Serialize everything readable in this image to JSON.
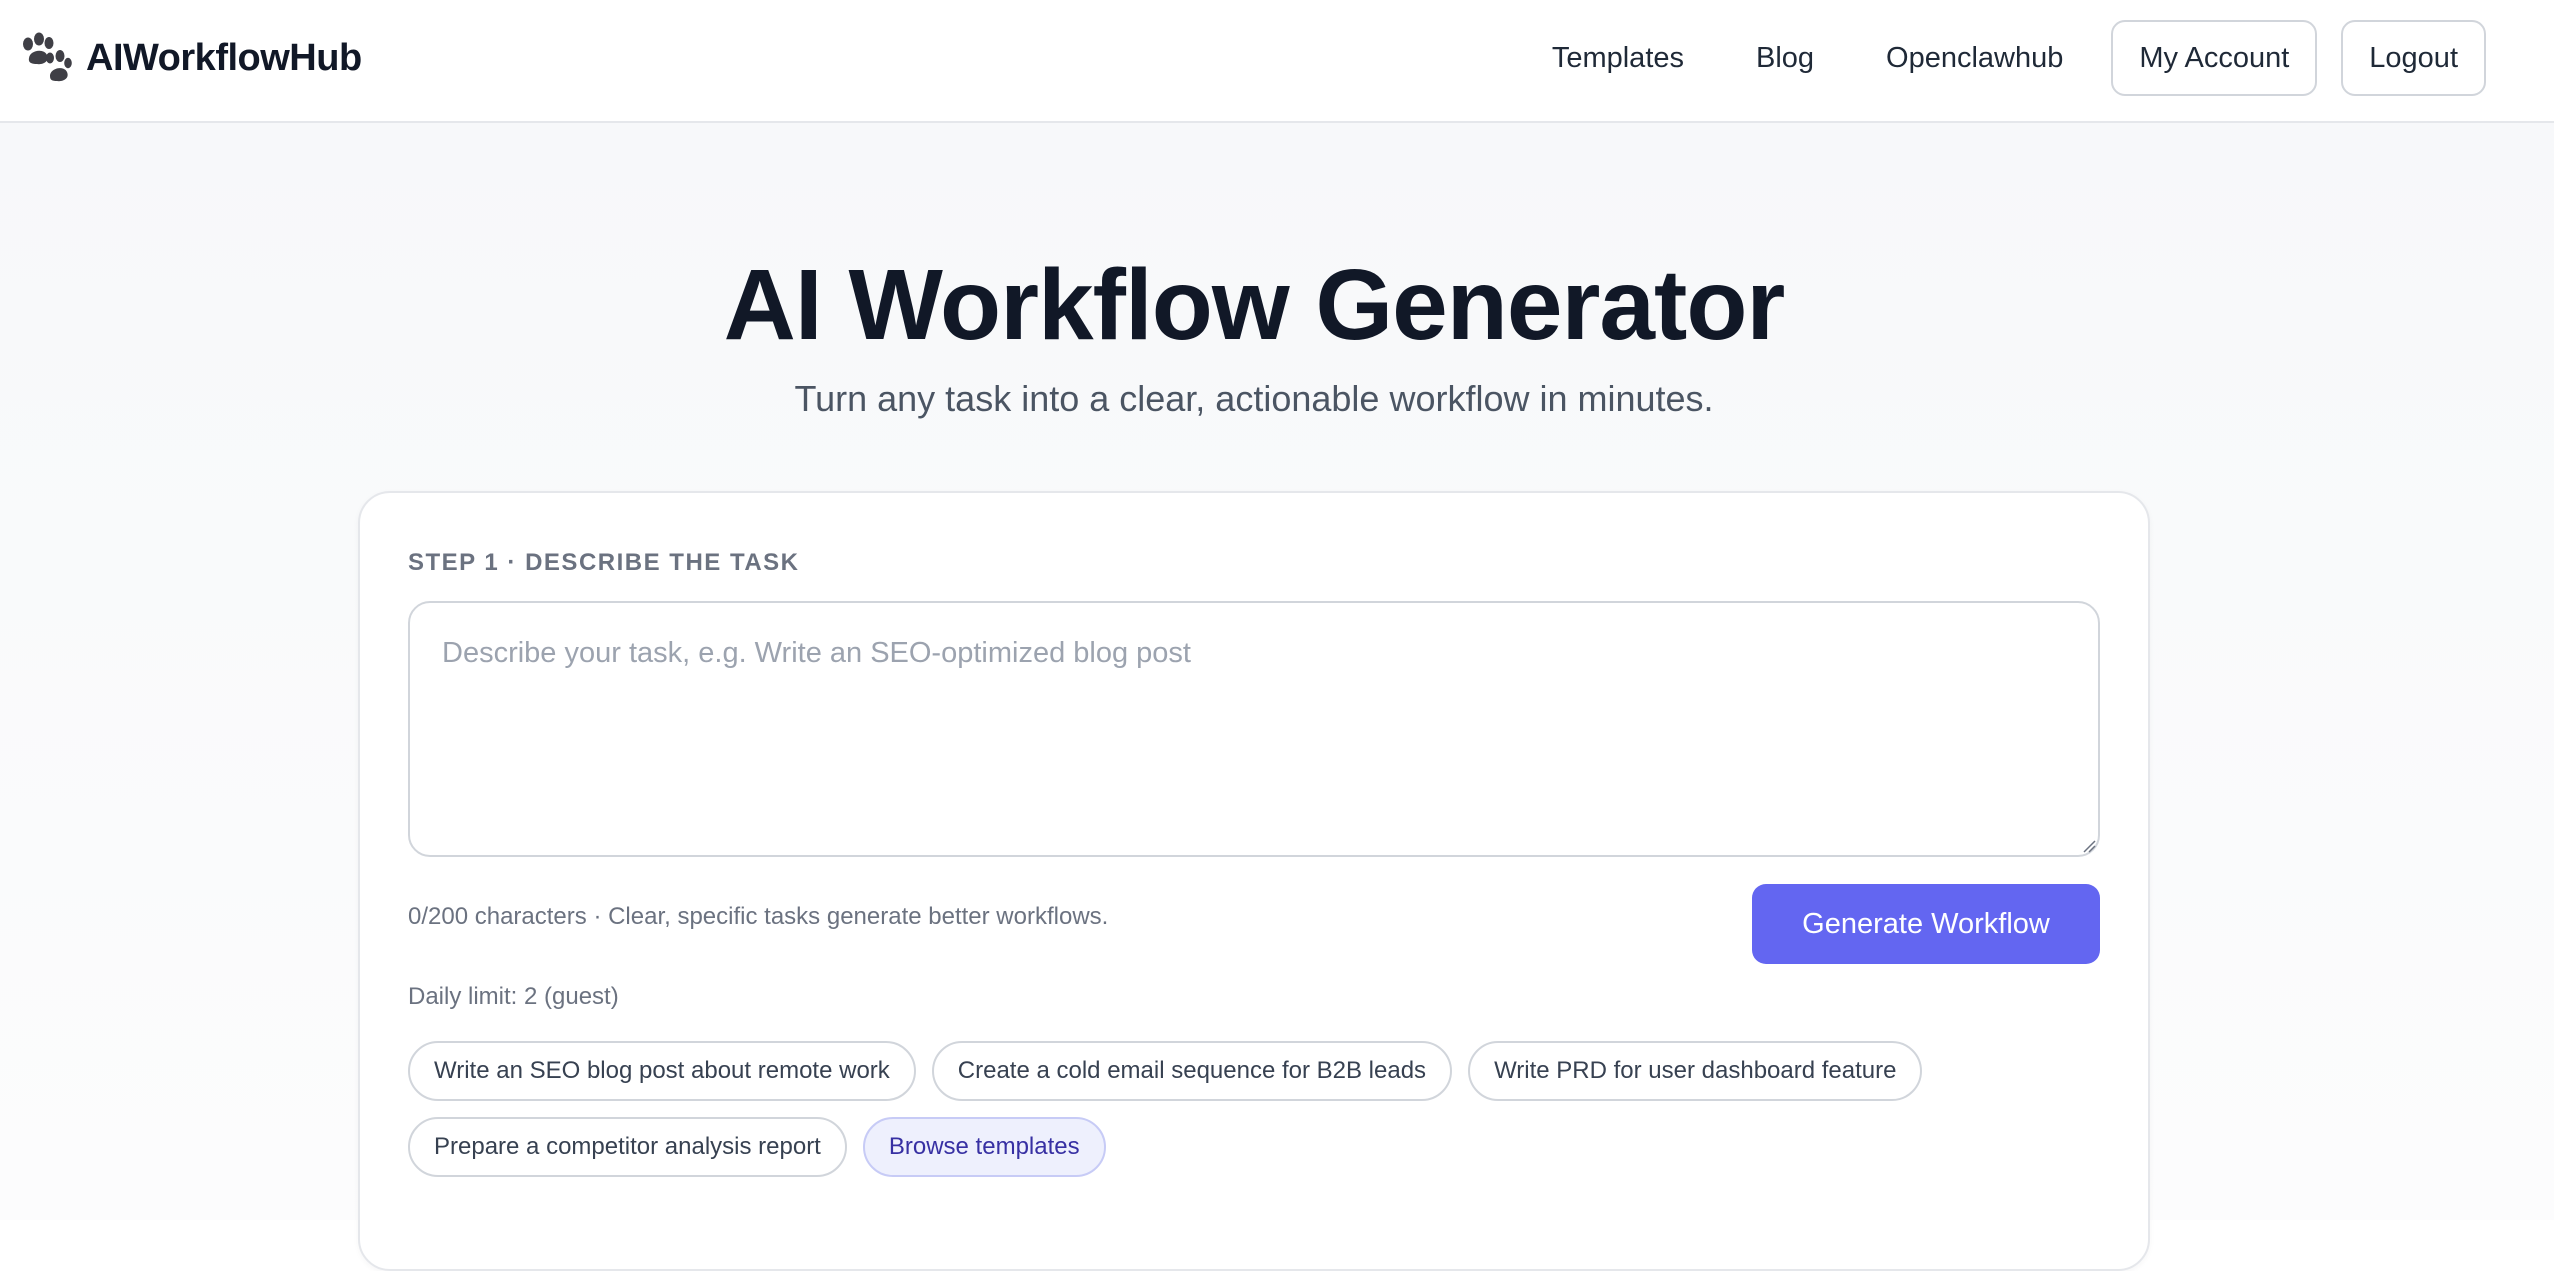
{
  "header": {
    "brand_icon": "paw-icon",
    "brand_name": "AIWorkflowHub",
    "nav": {
      "templates": "Templates",
      "blog": "Blog",
      "openclawhub": "Openclawhub"
    },
    "my_account": "My Account",
    "logout": "Logout"
  },
  "hero": {
    "title": "AI Workflow Generator",
    "subtitle": "Turn any task into a clear, actionable workflow in minutes."
  },
  "form": {
    "step_label": "STEP 1 · DESCRIBE THE TASK",
    "task_placeholder": "Describe your task, e.g. Write an SEO-optimized blog post",
    "task_value": "",
    "helper_text": "0/200 characters · Clear, specific tasks generate better workflows.",
    "generate_label": "Generate Workflow",
    "daily_limit": "Daily limit: 2 (guest)",
    "suggestions": [
      "Write an SEO blog post about remote work",
      "Create a cold email sequence for B2B leads",
      "Write PRD for user dashboard feature",
      "Prepare a competitor analysis report"
    ],
    "browse_label": "Browse templates"
  },
  "colors": {
    "accent": "#6366f1",
    "text": "#111827",
    "muted": "#6b7280",
    "chip_accent_bg": "#eef0fd"
  }
}
